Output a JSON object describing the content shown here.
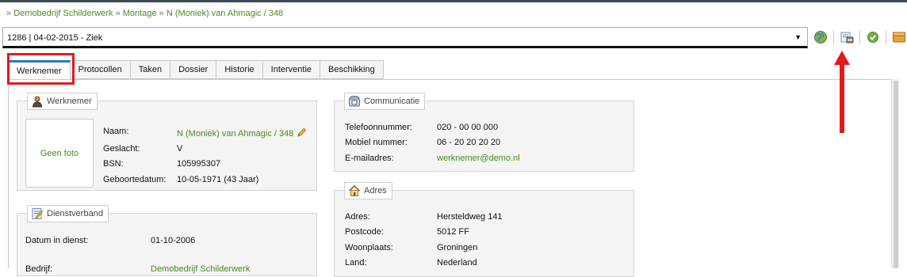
{
  "breadcrumb": {
    "prefix": "»",
    "items": [
      "Demobedrijf Schilderwerk",
      "Montage",
      "N (Moniek) van Ahmagic / 348"
    ],
    "separator": "»"
  },
  "case_select": {
    "value": "1286 | 04-02-2015 - Ziek",
    "caret": "▼"
  },
  "toolbar": {
    "icons": [
      "globe-icon",
      "document-view-icon",
      "check-icon",
      "archive-box-icon"
    ]
  },
  "tabs": [
    {
      "label": "Werknemer",
      "active": true
    },
    {
      "label": "Protocollen"
    },
    {
      "label": "Taken"
    },
    {
      "label": "Dossier"
    },
    {
      "label": "Historie"
    },
    {
      "label": "Interventie"
    },
    {
      "label": "Beschikking"
    }
  ],
  "employee": {
    "legend": "Werknemer",
    "photo_text": "Geen foto",
    "fields": [
      {
        "label": "Naam:",
        "value": "N (Moniek) van Ahmagic / 348",
        "link": true
      },
      {
        "label": "Geslacht:",
        "value": "V"
      },
      {
        "label": "BSN:",
        "value": "105995307"
      },
      {
        "label": "Geboortedatum:",
        "value": "10-05-1971 (43 Jaar)"
      }
    ]
  },
  "employment": {
    "legend": "Dienstverband",
    "fields": [
      {
        "label": "Datum in dienst:",
        "value": "01-10-2006"
      },
      {
        "label": "Bedrijf:",
        "value": "Demobedrijf Schilderwerk",
        "link": true
      }
    ]
  },
  "communication": {
    "legend": "Communicatie",
    "fields": [
      {
        "label": "Telefoonnummer:",
        "value": "020 - 00 00 000"
      },
      {
        "label": "Mobiel nummer:",
        "value": "06 - 20 20 20 20"
      },
      {
        "label": "E-mailadres:",
        "value": "werknemer@demo.nl",
        "link": true
      }
    ]
  },
  "address": {
    "legend": "Adres",
    "fields": [
      {
        "label": "Adres:",
        "value": "Hersteldweg 141"
      },
      {
        "label": "Postcode:",
        "value": "5012 FF"
      },
      {
        "label": "Woonplaats:",
        "value": "Groningen"
      },
      {
        "label": "Land:",
        "value": "Nederland"
      }
    ]
  },
  "colors": {
    "link": "#4a8a1c",
    "tab_accent": "#2a78c2",
    "highlight": "#e01b1b"
  }
}
